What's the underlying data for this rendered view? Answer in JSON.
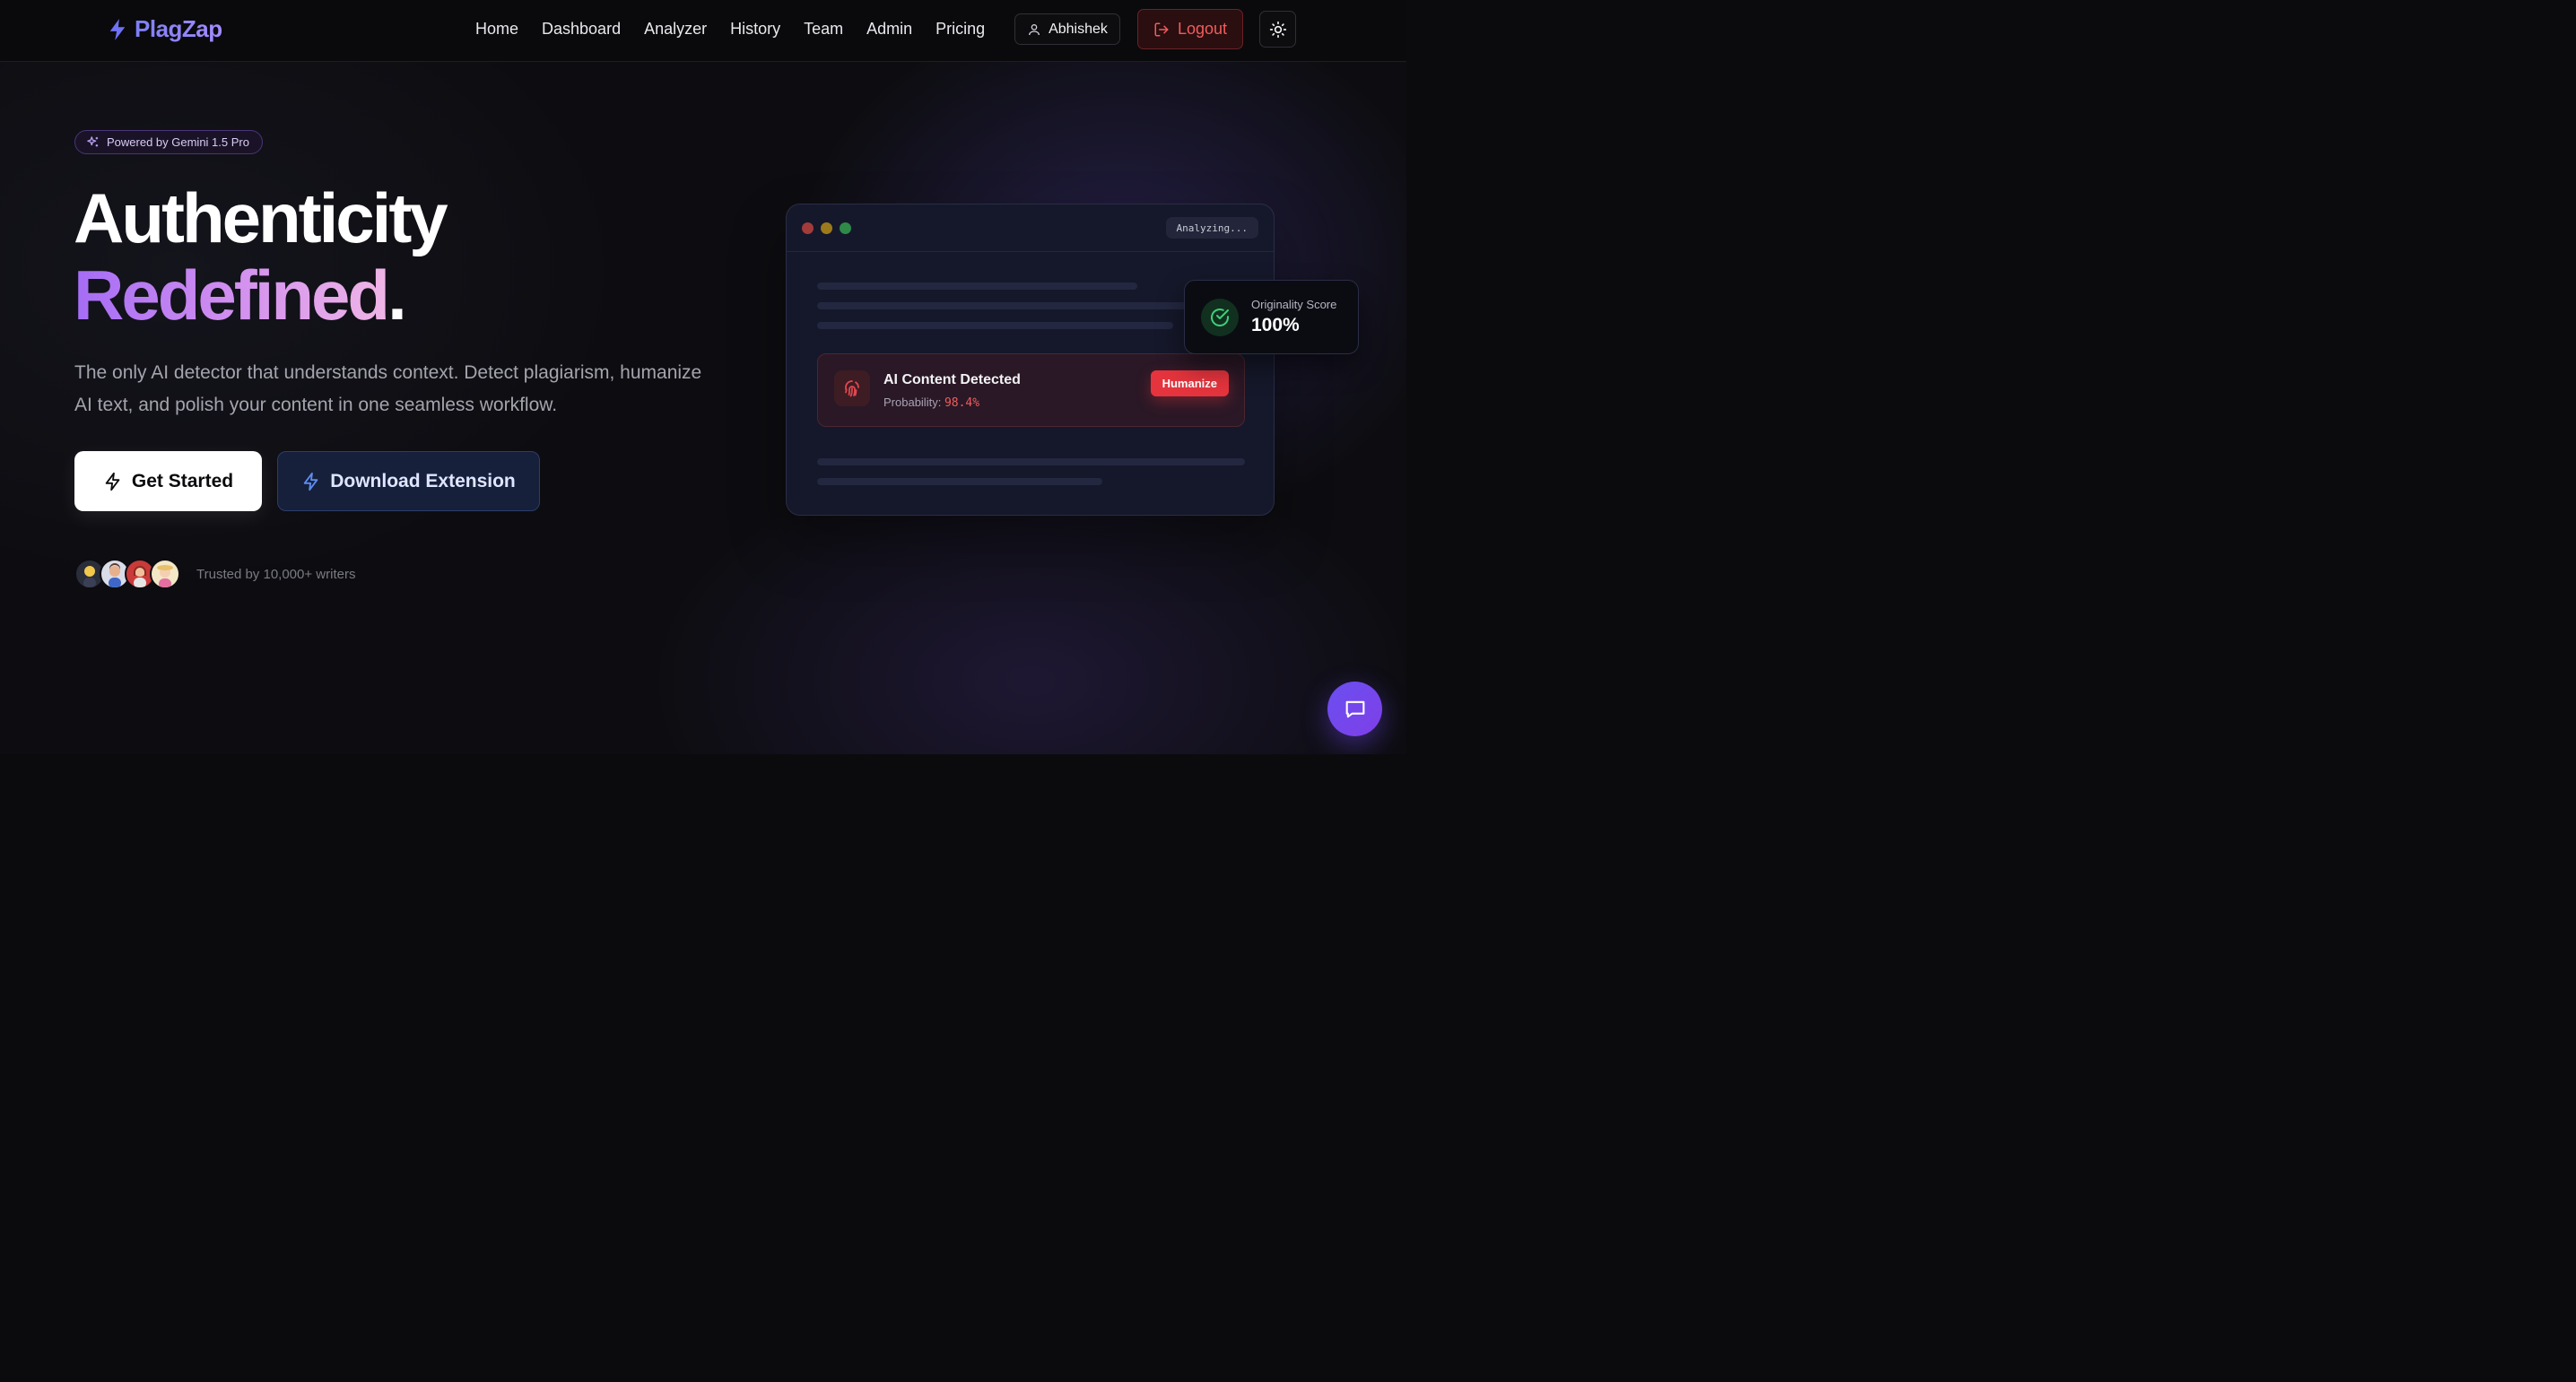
{
  "brand": {
    "name": "PlagZap",
    "accent": "#7c7ff5"
  },
  "nav": {
    "links": [
      "Home",
      "Dashboard",
      "Analyzer",
      "History",
      "Team",
      "Admin",
      "Pricing"
    ],
    "user": "Abhishek",
    "logout": "Logout"
  },
  "hero": {
    "badge": "Powered by Gemini 1.5 Pro",
    "title_line1": "Authenticity",
    "title_line2": "Redefined",
    "title_dot": ".",
    "lead": "The only AI detector that understands context. Detect plagiarism, humanize AI text, and polish your content in one seamless workflow.",
    "cta_primary": "Get Started",
    "cta_secondary": "Download Extension",
    "trust": "Trusted by 10,000+ writers"
  },
  "mock": {
    "status": "Analyzing...",
    "alert_title": "AI Content Detected",
    "alert_prob_label": "Probability:",
    "alert_prob_value": "98.4%",
    "alert_action": "Humanize",
    "score_label": "Originality Score",
    "score_value": "100%"
  },
  "colors": {
    "danger": "#e5343d",
    "success": "#22c55e",
    "gradient_start": "#a46cf5",
    "gradient_end": "#f0b5e6"
  }
}
